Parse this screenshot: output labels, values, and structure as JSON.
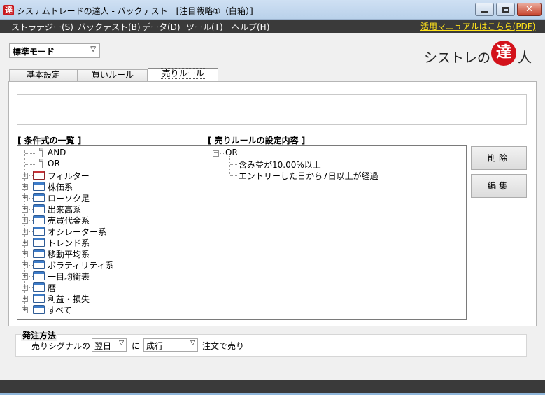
{
  "window": {
    "title": "システムトレードの達人 - バックテスト　[注目戦略①（白箱）]",
    "app_icon_glyph": "達"
  },
  "menu": {
    "items": [
      "ストラテジー(S)",
      "バックテスト(B)",
      "データ(D)",
      "ツール(T)",
      "ヘルプ(H)"
    ],
    "manual_link": "活用マニュアルはこちら(PDF)",
    "link_color": "#ffe21a"
  },
  "mode": {
    "selected": "標準モード"
  },
  "brand": {
    "prefix": "シストレの",
    "seal": "達",
    "suffix": "人",
    "seal_color": "#d3121b"
  },
  "tabs": [
    {
      "label": "基本設定",
      "selected": false
    },
    {
      "label": "買いルール",
      "selected": false
    },
    {
      "label": "売りルール",
      "selected": true
    }
  ],
  "description": "",
  "condition_list": {
    "header": "[ 条件式の一覧 ]",
    "items": [
      {
        "label": "AND",
        "icon": "page-icon",
        "expandable": false
      },
      {
        "label": "OR",
        "icon": "page-icon",
        "expandable": false
      },
      {
        "label": "フィルター",
        "icon": "red-book-icon",
        "expandable": true
      },
      {
        "label": "株価系",
        "icon": "book-icon",
        "expandable": true
      },
      {
        "label": "ローソク足",
        "icon": "book-icon",
        "expandable": true
      },
      {
        "label": "出来高系",
        "icon": "book-icon",
        "expandable": true
      },
      {
        "label": "売買代金系",
        "icon": "book-icon",
        "expandable": true
      },
      {
        "label": "オシレーター系",
        "icon": "book-icon",
        "expandable": true
      },
      {
        "label": "トレンド系",
        "icon": "book-icon",
        "expandable": true
      },
      {
        "label": "移動平均系",
        "icon": "book-icon",
        "expandable": true
      },
      {
        "label": "ボラティリティ系",
        "icon": "book-icon",
        "expandable": true
      },
      {
        "label": "一目均衡表",
        "icon": "book-icon",
        "expandable": true
      },
      {
        "label": "暦",
        "icon": "book-icon",
        "expandable": true
      },
      {
        "label": "利益・損失",
        "icon": "book-icon",
        "expandable": true
      },
      {
        "label": "すべて",
        "icon": "book-icon",
        "expandable": true
      }
    ]
  },
  "sell_rule": {
    "header": "[ 売りルールの設定内容 ]",
    "root": "OR",
    "children": [
      "含み益が10.00%以上",
      "エントリーした日から7日以上が経過"
    ]
  },
  "buttons": {
    "delete": "削除",
    "edit": "編集"
  },
  "order": {
    "title": "発注方法",
    "prefix": "売りシグナルの",
    "timing": "翌日",
    "connector": "に",
    "type": "成行",
    "suffix": "注文で売り"
  }
}
